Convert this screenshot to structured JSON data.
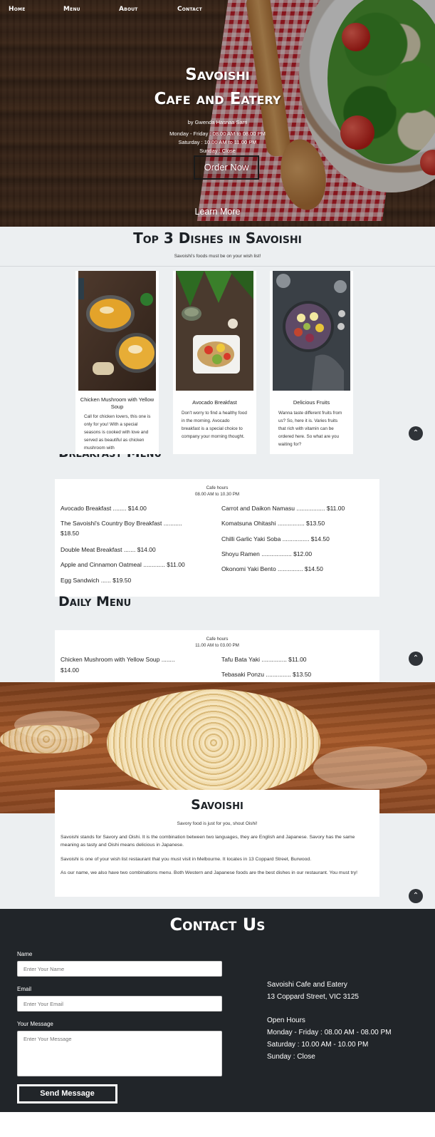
{
  "nav": {
    "items": [
      "Home",
      "Menu",
      "About",
      "Contact"
    ]
  },
  "hero": {
    "title_line1": "Savoishi",
    "title_line2": "Cafe and Eatery",
    "byline": "by Gwenda Hasnaa Sarri",
    "hours_weekday": "Monday - Friday : 08.00 AM to 08.00 PM",
    "hours_saturday": "Saturday : 10.00 AM to 11.00 PM",
    "hours_sunday": "Sunday : Close",
    "order_button": "Order Now",
    "learn_more": "Learn More"
  },
  "top3": {
    "title": "Top 3 Dishes in Savoishi",
    "subtitle": "Savoishi's foods must be on your wish list!",
    "dishes": [
      {
        "name": "Chicken Mushroom with Yellow Soup",
        "description": "Call for chicken lovers, this one is only for you! With a special seasons is cooked with love and served as beautiful as chicken mushroom with"
      },
      {
        "name": "Avocado Breakfast",
        "description": "Don't worry to find a healthy food in the morning. Avocado breakfast is a special choice to company your morning thought."
      },
      {
        "name": "Delicious Fruits",
        "description": "Wanna taste different fruits from us? So, here it is. Varies fruits that rich with vitamin can be ordered here. So what are you waiting for?"
      }
    ]
  },
  "breakfast": {
    "title": "Breakfast Menu",
    "hours_label": "Cafe hours",
    "hours": "08.00 AM to 10.30 PM",
    "left": [
      "Avocado Breakfast ........ $14.00",
      "The Savoishi's Country Boy Breakfast ...........",
      "$18.50",
      "Double Meat Breakfast ....... $14.00",
      "Apple and Cinnamon Oatmeal ............. $11.00",
      "Egg Sandwich ...... $19.50"
    ],
    "right": [
      "Carrot and Daikon Namasu ................. $11.00",
      "Komatsuna Ohitashi ................ $13.50",
      "Chilli Garlic Yaki Soba ................ $14.50",
      "Shoyu Ramen .................. $12.00",
      "Okonomi Yaki Bento ............... $14.50"
    ]
  },
  "daily": {
    "title": "Daily Menu",
    "hours_label": "Cafe hours",
    "hours": "11.00 AM to 03.00 PM",
    "left": [
      "Chicken Mushroom with Yellow Soup ........",
      "$14.00"
    ],
    "right": [
      "Tafu Bata Yaki ............... $11.00",
      "Tebasaki Ponzu ............... $13.50"
    ]
  },
  "about": {
    "title": "Savoishi",
    "tagline": "Savory food is just for you, shout Oishi!",
    "p1": "Savoishi stands for Savory and Oishi. It is the combination between two languages, they are English and Japanese. Savory has the same meaning as tasty and Oishi means delicious in Japanese.",
    "p2": "Savoishi is one of your wish list restaurant that you must visit in Melbourne. It locates in 13 Coppard Street, Burwood.",
    "p3": "As our name, we also have two combinations menu. Both Western and Japanese foods are the best dishes in our restaurant. You must try!"
  },
  "contact": {
    "title": "Contact Us",
    "name_label": "Name",
    "name_placeholder": "Enter Your Name",
    "email_label": "Email",
    "email_placeholder": "Enter Your Email",
    "message_label": "Your Message",
    "message_placeholder": "Enter Your Message",
    "send_button": "Send Message",
    "business_name": "Savoishi Cafe and Eatery",
    "address": "13 Coppard Street, VIC 3125",
    "open_hours_label": "Open Hours",
    "hours_weekday": "Monday - Friday : 08.00 AM - 08.00 PM",
    "hours_saturday": "Saturday : 10.00 AM - 10.00 PM",
    "hours_sunday": "Sunday : Close"
  },
  "icons": {
    "scroll_top": "chevron-up-icon"
  },
  "colors": {
    "dark": "#212529",
    "section_bg": "#eceff1",
    "heading": "#1c2126"
  }
}
